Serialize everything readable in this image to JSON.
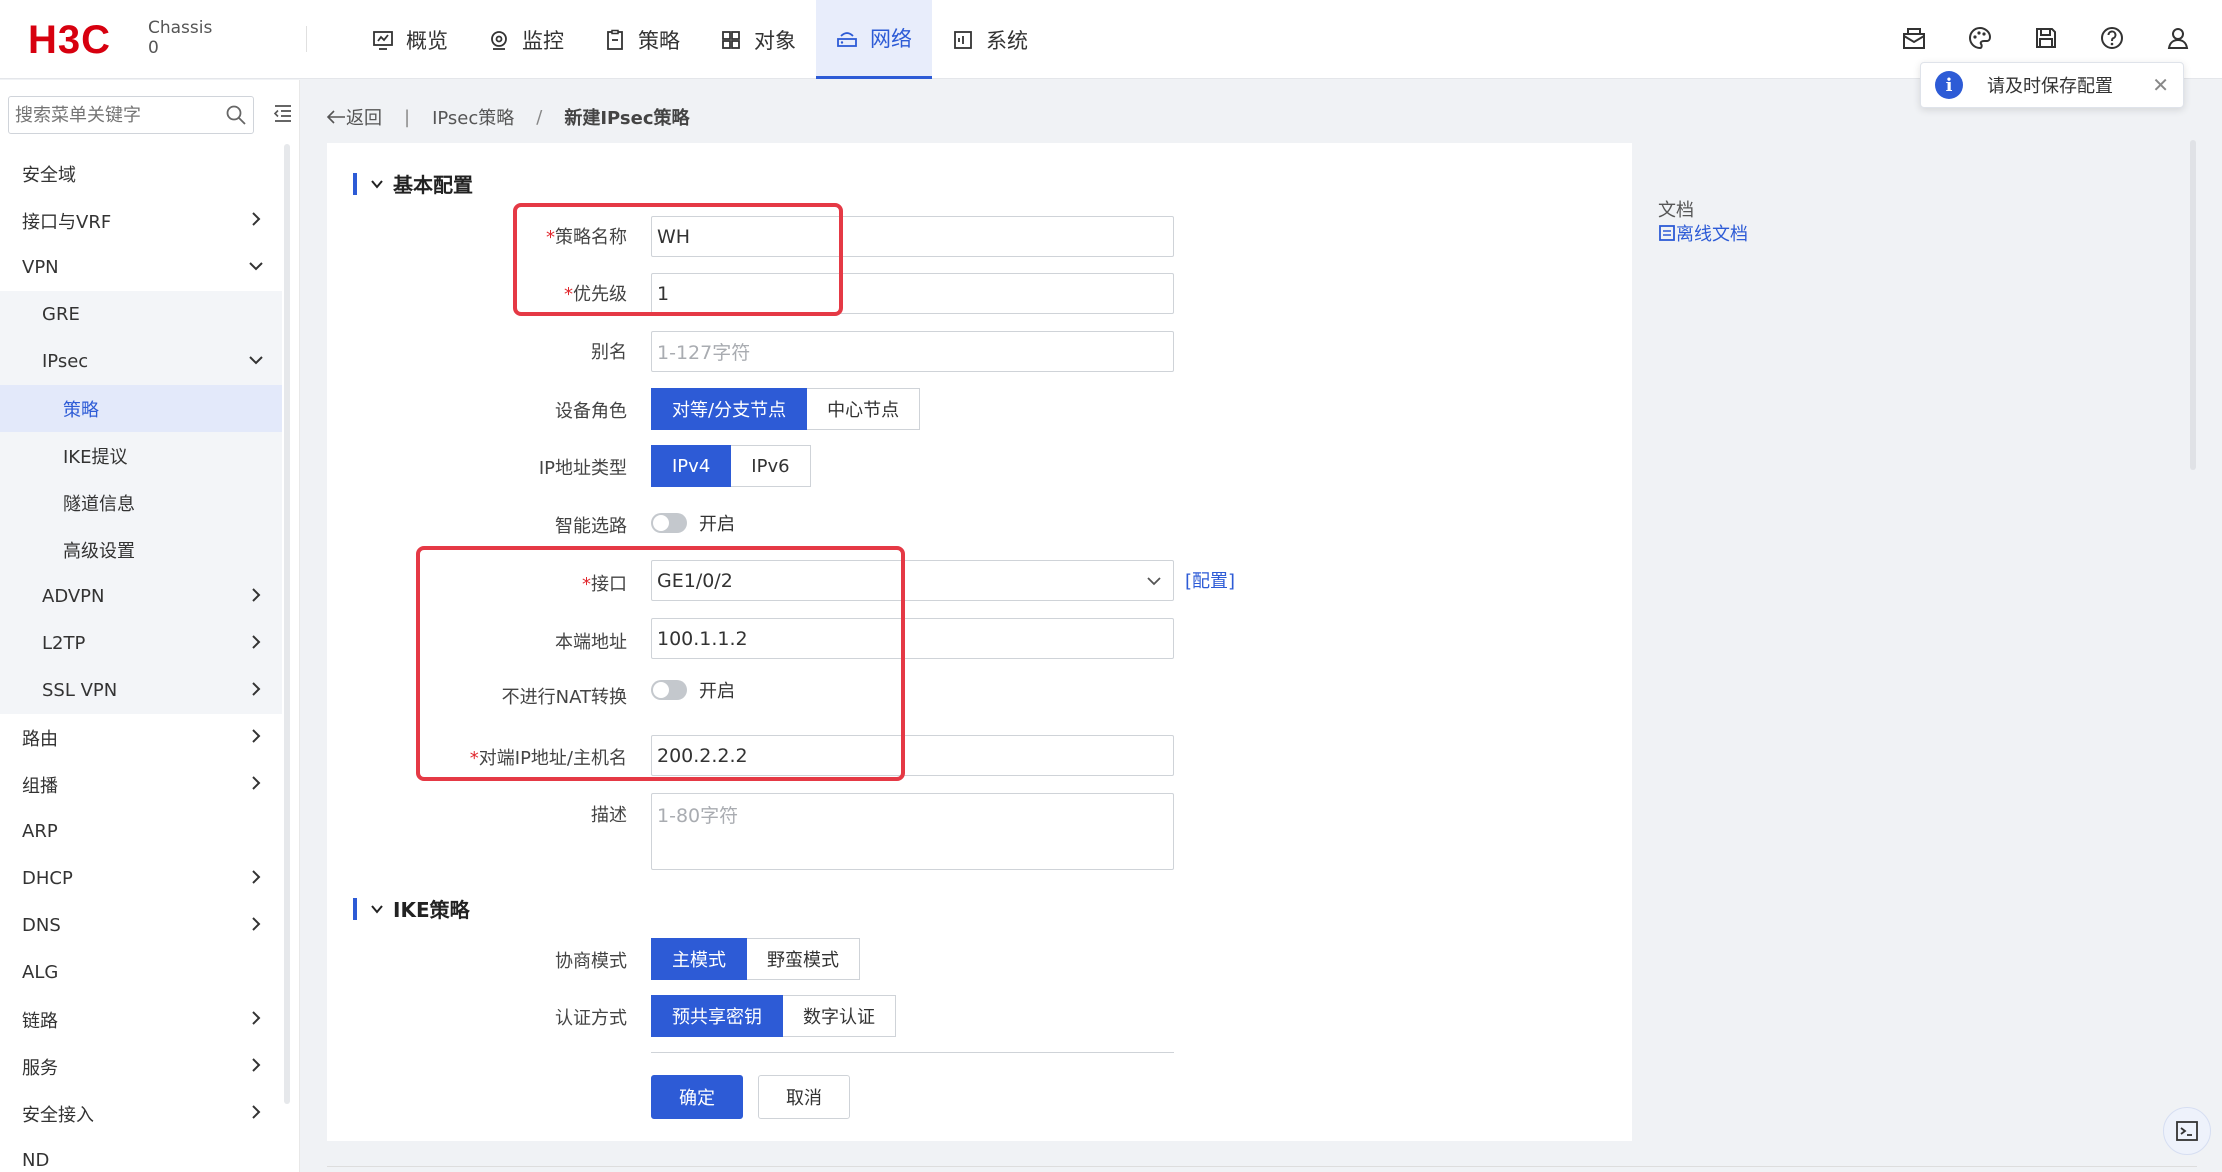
{
  "brand": {
    "logo": "H3C",
    "chassis_label": "Chassis",
    "chassis_value": "0"
  },
  "nav": [
    {
      "label": "概览",
      "icon": "overview-icon"
    },
    {
      "label": "监控",
      "icon": "monitor-icon"
    },
    {
      "label": "策略",
      "icon": "policy-icon"
    },
    {
      "label": "对象",
      "icon": "object-icon"
    },
    {
      "label": "网络",
      "icon": "network-icon",
      "active": true
    },
    {
      "label": "系统",
      "icon": "system-icon"
    }
  ],
  "toast": {
    "message": "请及时保存配置",
    "close": "✕"
  },
  "sidebar": {
    "search_placeholder": "搜索菜单关键字",
    "items": [
      {
        "label": "安全域"
      },
      {
        "label": "接口与VRF"
      },
      {
        "label": "VPN"
      },
      {
        "label": "GRE"
      },
      {
        "label": "IPsec"
      },
      {
        "label": "策略"
      },
      {
        "label": "IKE提议"
      },
      {
        "label": "隧道信息"
      },
      {
        "label": "高级设置"
      },
      {
        "label": "ADVPN"
      },
      {
        "label": "L2TP"
      },
      {
        "label": "SSL VPN"
      },
      {
        "label": "路由"
      },
      {
        "label": "组播"
      },
      {
        "label": "ARP"
      },
      {
        "label": "DHCP"
      },
      {
        "label": "DNS"
      },
      {
        "label": "ALG"
      },
      {
        "label": "链路"
      },
      {
        "label": "服务"
      },
      {
        "label": "安全接入"
      },
      {
        "label": "ND"
      }
    ]
  },
  "breadcrumb": {
    "back": "返回",
    "parent": "IPsec策略",
    "sep": "/",
    "current": "新建IPsec策略"
  },
  "basic": {
    "title": "基本配置",
    "policy_name_label": "策略名称",
    "policy_name_value": "WH",
    "priority_label": "优先级",
    "priority_value": "1",
    "alias_label": "别名",
    "alias_placeholder": "1-127字符",
    "role_label": "设备角色",
    "role_options": [
      "对等/分支节点",
      "中心节点"
    ],
    "ip_type_label": "IP地址类型",
    "ip_type_options": [
      "IPv4",
      "IPv6"
    ],
    "smart_route_label": "智能选路",
    "smart_route_text": "开启",
    "interface_label": "接口",
    "interface_value": "GE1/0/2",
    "config_link": "[配置]",
    "local_addr_label": "本端地址",
    "local_addr_value": "100.1.1.2",
    "no_nat_label": "不进行NAT转换",
    "no_nat_text": "开启",
    "remote_label": "对端IP地址/主机名",
    "remote_value": "200.2.2.2",
    "desc_label": "描述",
    "desc_placeholder": "1-80字符",
    "required_mark": "*"
  },
  "ike": {
    "title": "IKE策略",
    "mode_label": "协商模式",
    "mode_options": [
      "主模式",
      "野蛮模式"
    ],
    "auth_label": "认证方式",
    "auth_options": [
      "预共享密钥",
      "数字认证"
    ]
  },
  "actions": {
    "ok": "确定",
    "cancel": "取消"
  },
  "doc": {
    "title": "文档",
    "offline": "离线文档"
  },
  "colors": {
    "accent": "#2d5bd6",
    "brand": "#d7000f",
    "highlight": "#e53945"
  }
}
